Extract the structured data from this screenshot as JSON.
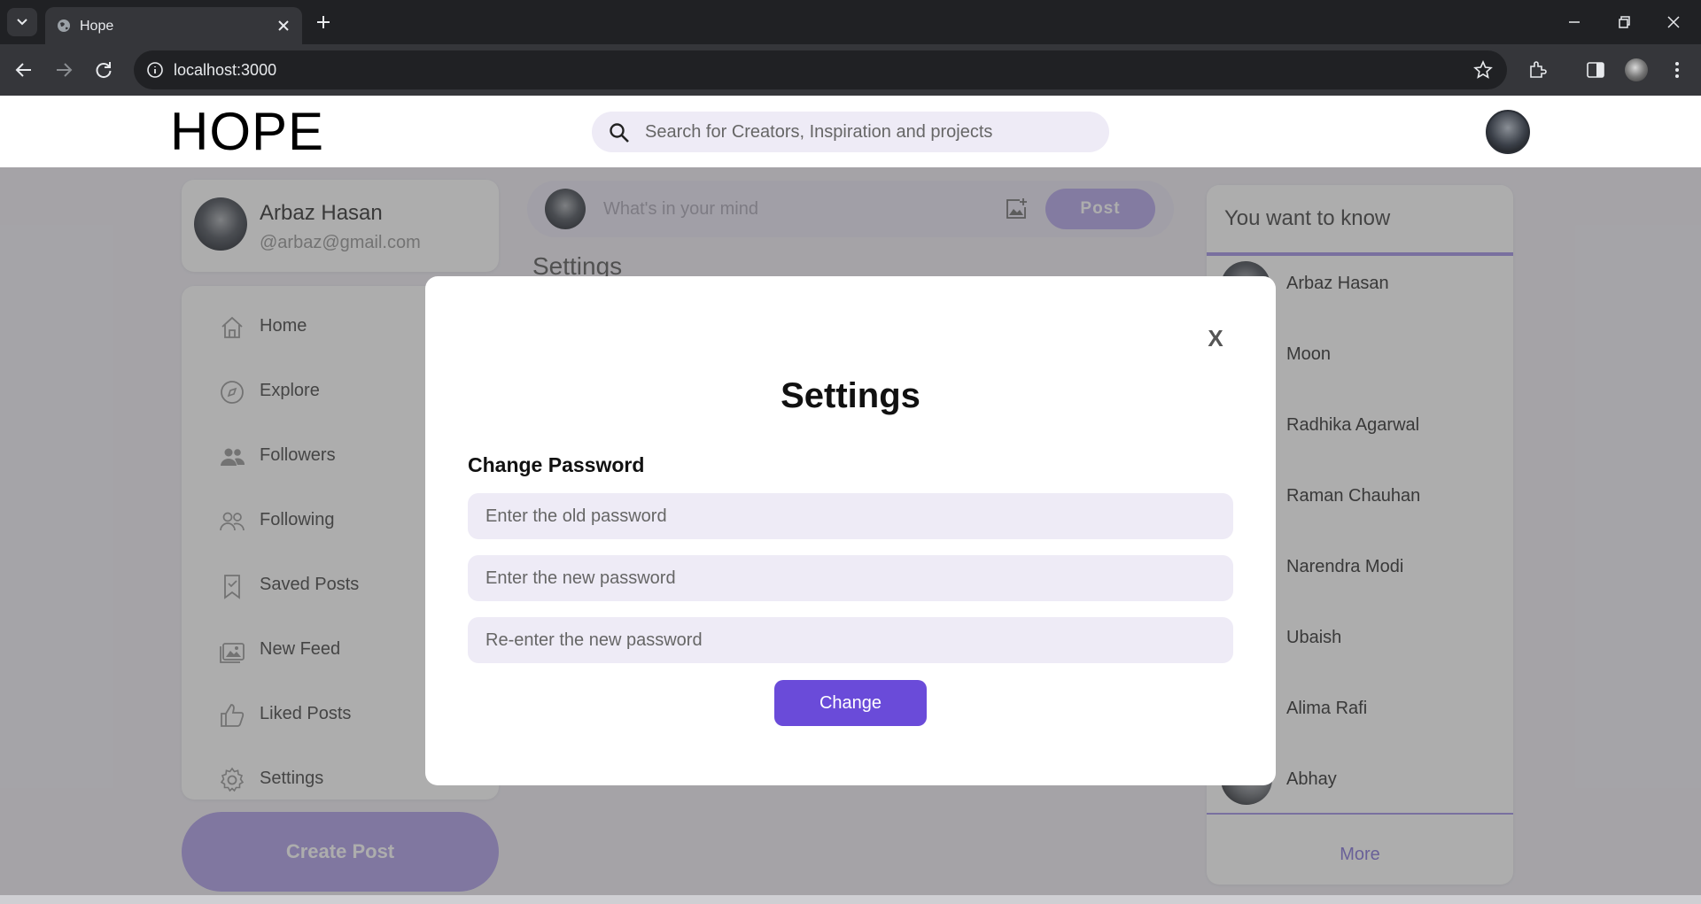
{
  "browser": {
    "tab_title": "Hope",
    "url": "localhost:3000"
  },
  "header": {
    "logo": "HOPE",
    "search_placeholder": "Search for Creators, Inspiration and projects"
  },
  "profile": {
    "name": "Arbaz Hasan",
    "email": "@arbaz@gmail.com"
  },
  "menu": {
    "items": [
      {
        "label": "Home",
        "icon": "home-icon"
      },
      {
        "label": "Explore",
        "icon": "compass-icon"
      },
      {
        "label": "Followers",
        "icon": "users-icon"
      },
      {
        "label": "Following",
        "icon": "users-outline-icon"
      },
      {
        "label": "Saved Posts",
        "icon": "bookmark-icon"
      },
      {
        "label": "New Feed",
        "icon": "image-icon"
      },
      {
        "label": "Liked Posts",
        "icon": "thumbs-up-icon"
      },
      {
        "label": "Settings",
        "icon": "gear-icon"
      }
    ],
    "create_post": "Create Post"
  },
  "composer": {
    "placeholder": "What's in your mind",
    "post_label": "Post"
  },
  "main": {
    "section_title": "Settings"
  },
  "suggestions": {
    "title": "You want to know",
    "people": [
      "Arbaz Hasan",
      "Moon",
      "Radhika Agarwal",
      "Raman Chauhan",
      "Narendra Modi",
      "Ubaish",
      "Alima Rafi",
      "Abhay"
    ],
    "more_label": "More"
  },
  "modal": {
    "close_label": "X",
    "title": "Settings",
    "section_label": "Change Password",
    "old_placeholder": "Enter the old password",
    "new_placeholder": "Enter the new password",
    "reenter_placeholder": "Re-enter the new password",
    "submit_label": "Change"
  },
  "colors": {
    "accent": "#6a4bd9",
    "accent_light": "#bdb0ec",
    "input_bg": "#eeebf6"
  }
}
